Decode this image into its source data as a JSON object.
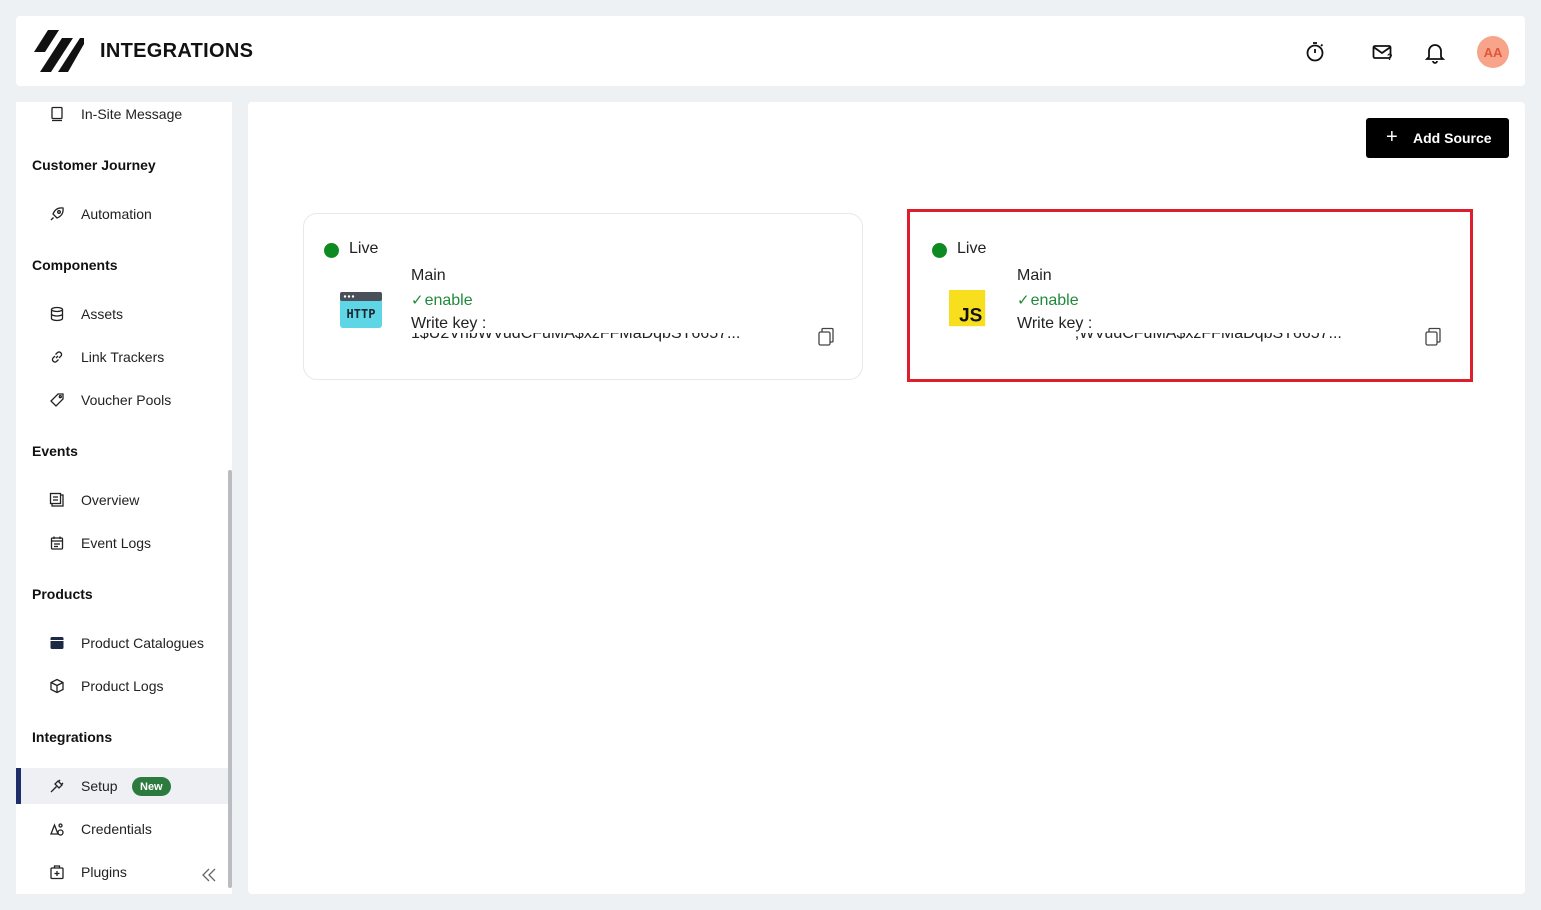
{
  "header": {
    "title": "INTEGRATIONS",
    "icons": [
      "stopwatch-icon",
      "mail-question-icon",
      "bell-icon"
    ],
    "avatar_initials": "AA"
  },
  "sidebar": {
    "items_top": [
      {
        "label": "In-Site Message",
        "icon": "message-box-icon"
      }
    ],
    "sections": [
      {
        "title": "Customer Journey",
        "items": [
          {
            "label": "Automation",
            "icon": "rocket-icon"
          }
        ]
      },
      {
        "title": "Components",
        "items": [
          {
            "label": "Assets",
            "icon": "database-icon"
          },
          {
            "label": "Link Trackers",
            "icon": "link-icon"
          },
          {
            "label": "Voucher Pools",
            "icon": "tag-icon"
          }
        ]
      },
      {
        "title": "Events",
        "items": [
          {
            "label": "Overview",
            "icon": "overview-icon"
          },
          {
            "label": "Event Logs",
            "icon": "calendar-log-icon"
          }
        ]
      },
      {
        "title": "Products",
        "items": [
          {
            "label": "Product Catalogues",
            "icon": "catalogue-icon"
          },
          {
            "label": "Product Logs",
            "icon": "cube-icon"
          }
        ]
      },
      {
        "title": "Integrations",
        "items": [
          {
            "label": "Setup",
            "icon": "plug-icon",
            "badge": "New",
            "active": true
          },
          {
            "label": "Credentials",
            "icon": "key-shapes-icon"
          },
          {
            "label": "Plugins",
            "icon": "plugin-box-icon"
          }
        ]
      }
    ]
  },
  "main": {
    "add_source_label": "Add Source",
    "cards": [
      {
        "status_label": "Live",
        "source_icon": "http-icon",
        "name": "Main",
        "state": "enable",
        "write_key_label": "Write key :",
        "write_key_value": "1$U2VhbWVudCFuMA$xzFFMaDqbST6657..."
      },
      {
        "status_label": "Live",
        "source_icon": "javascript-icon",
        "name": "Main",
        "state": "enable",
        "write_key_label": "Write key :",
        "write_key_value": "             ,WVudCFuMA$xzFFMaDqbST6657..."
      }
    ]
  },
  "colors": {
    "live": "#0e8a22",
    "enable": "#1f8a3a",
    "highlight": "#dd1f2d",
    "active_bar": "#1f2d6b",
    "badge_new": "#2d7a3e",
    "avatar_bg": "#f7a48a"
  }
}
